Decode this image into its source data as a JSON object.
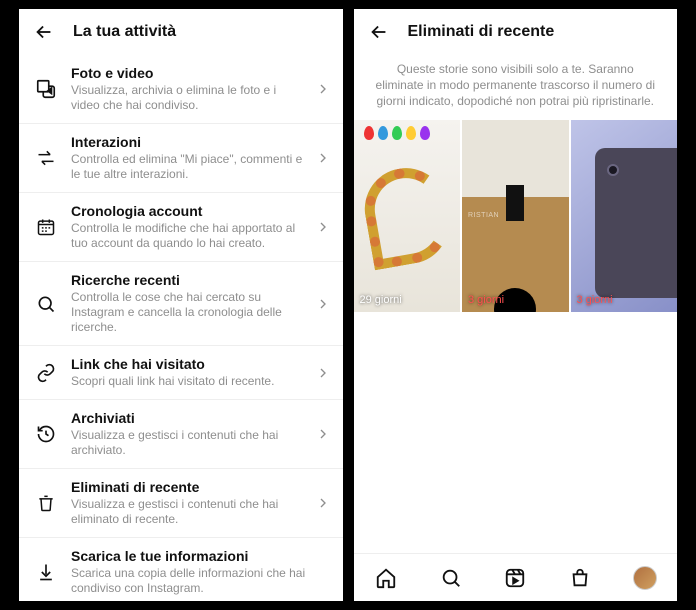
{
  "left": {
    "title": "La tua attività",
    "items": [
      {
        "icon": "photo-video-icon",
        "title": "Foto e video",
        "desc": "Visualizza, archivia o elimina le foto e i video che hai condiviso."
      },
      {
        "icon": "interactions-icon",
        "title": "Interazioni",
        "desc": "Controlla ed elimina \"Mi piace\", commenti e le tue altre interazioni."
      },
      {
        "icon": "calendar-icon",
        "title": "Cronologia account",
        "desc": "Controlla le modifiche che hai apportato al tuo account da quando lo hai creato."
      },
      {
        "icon": "search-icon",
        "title": "Ricerche recenti",
        "desc": "Controlla le cose che hai cercato su Instagram e cancella la cronologia delle ricerche."
      },
      {
        "icon": "link-icon",
        "title": "Link che hai visitato",
        "desc": "Scopri quali link hai visitato di recente."
      },
      {
        "icon": "history-icon",
        "title": "Archiviati",
        "desc": "Visualizza e gestisci i contenuti che hai archiviato."
      },
      {
        "icon": "trash-icon",
        "title": "Eliminati di recente",
        "desc": "Visualizza e gestisci i contenuti che hai eliminato di recente."
      },
      {
        "icon": "download-icon",
        "title": "Scarica le tue informazioni",
        "desc": "Scarica una copia delle informazioni che hai condiviso con Instagram."
      }
    ]
  },
  "right": {
    "title": "Eliminati di recente",
    "info": "Queste storie sono visibili solo a te. Saranno eliminate in modo permanente trascorso il numero di giorni indicato, dopodiché non potrai più ripristinarle.",
    "thumbs": [
      {
        "label": "29 giorni",
        "red": false
      },
      {
        "label": "3 giorni",
        "red": true
      },
      {
        "label": "3 giorni",
        "red": true
      }
    ],
    "watermark": "RISTIAN"
  }
}
